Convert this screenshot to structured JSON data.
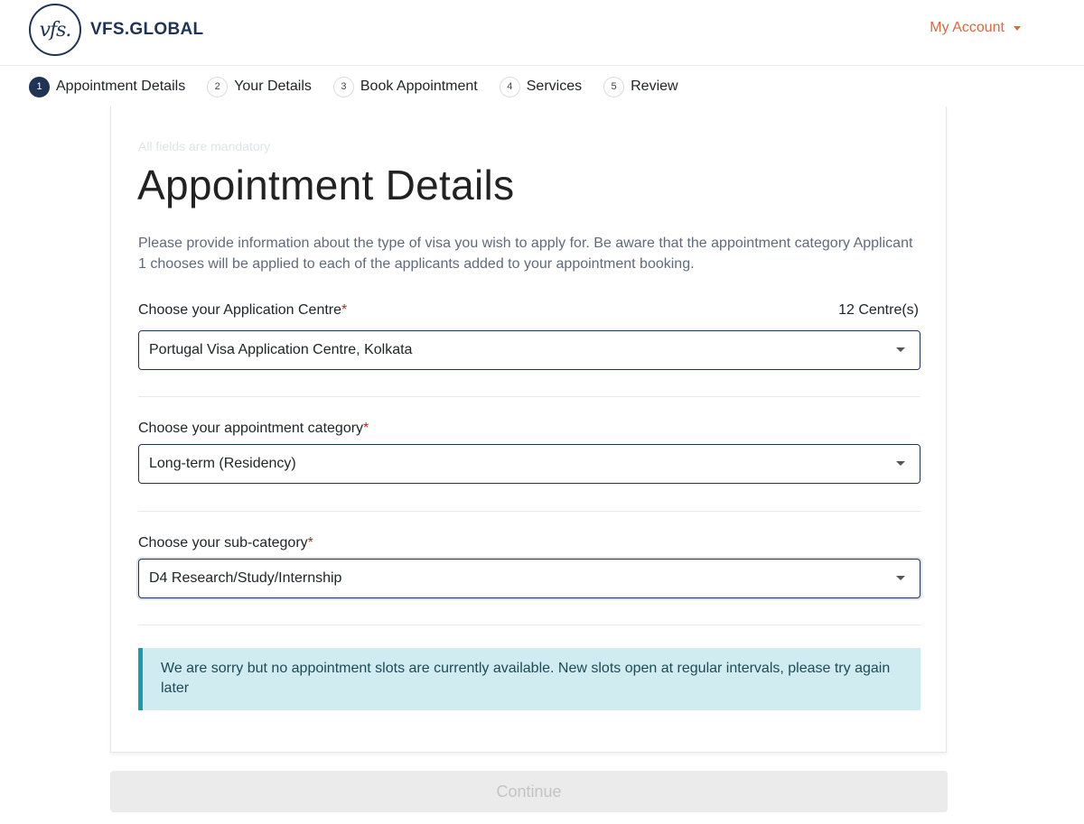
{
  "header": {
    "logo_mark": "vfs.",
    "logo_text": "VFS.GLOBAL",
    "account_label": "My Account"
  },
  "steps": [
    {
      "num": "1",
      "label": "Appointment Details",
      "active": true
    },
    {
      "num": "2",
      "label": "Your Details",
      "active": false
    },
    {
      "num": "3",
      "label": "Book Appointment",
      "active": false
    },
    {
      "num": "4",
      "label": "Services",
      "active": false
    },
    {
      "num": "5",
      "label": "Review",
      "active": false
    }
  ],
  "form": {
    "mandatory_note": "All fields are mandatory",
    "title": "Appointment Details",
    "description": "Please provide information about the type of visa you wish to apply for. Be aware that the appointment category Applicant 1 chooses will be applied to each of the applicants added to your appointment booking.",
    "required_mark": "*",
    "centre": {
      "label": "Choose your Application Centre",
      "count": "12 Centre(s)",
      "value": "Portugal Visa Application Centre, Kolkata"
    },
    "category": {
      "label": "Choose your appointment category",
      "value": "Long-term (Residency)"
    },
    "subcategory": {
      "label": "Choose your sub-category",
      "value": "D4 Research/Study/Internship"
    },
    "alert": "We are sorry but no appointment slots are currently available. New slots open at regular intervals, please try again later",
    "continue_label": "Continue"
  },
  "colors": {
    "brand_navy": "#1f3455",
    "account_orange": "#d96a3b",
    "alert_bg": "#d0ecf0",
    "alert_border": "#1a9cad",
    "required_red": "#b42828"
  },
  "icons": {
    "account_dropdown": "caret-down-icon",
    "select_dropdown": "caret-down-icon"
  }
}
